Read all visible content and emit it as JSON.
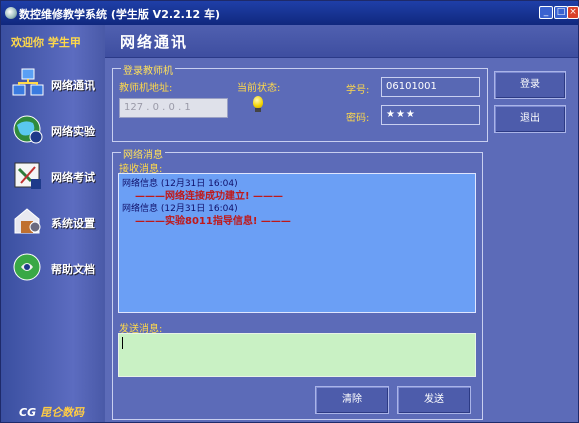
{
  "window": {
    "title": "数控维修教学系统 (学生版 V2.2.12 车)",
    "min_glyph": "_",
    "max_glyph": "□",
    "close_glyph": "×"
  },
  "sidebar": {
    "welcome": "欢迎你  学生甲",
    "items": [
      {
        "label": "网络通讯",
        "icon": "network-icon"
      },
      {
        "label": "网络实验",
        "icon": "globe-icon"
      },
      {
        "label": "网络考试",
        "icon": "exam-icon"
      },
      {
        "label": "系统设置",
        "icon": "settings-icon"
      },
      {
        "label": "帮助文档",
        "icon": "help-icon"
      }
    ],
    "brand_prefix": "CG",
    "brand_text": "昆仑数码"
  },
  "header": {
    "title": "网络通讯"
  },
  "login_group": {
    "legend": "登录教师机",
    "teacher_addr_label": "教师机地址:",
    "teacher_addr_value": "127 . 0 . 0 . 1",
    "status_label": "当前状态:",
    "student_id_label": "学号:",
    "student_id_value": "06101001",
    "password_label": "密码:",
    "password_value": "★★★",
    "login_button": "登录",
    "logout_button": "退出"
  },
  "message_group": {
    "legend": "网络消息",
    "receive_label": "接收消息:",
    "messages": [
      {
        "header": "网络信息 (12月31日 16:04)",
        "body": "———网络连接成功建立! ———"
      },
      {
        "header": "网络信息 (12月31日 16:04)",
        "body": "———实验8011指导信息! ———"
      }
    ],
    "send_label": "发送消息:",
    "send_value": "",
    "clear_button": "清除",
    "send_button": "发送"
  },
  "colors": {
    "sidebar": "#4a5aa8",
    "main_panel": "#5c6bb8",
    "receive_box": "#6b9ff5",
    "send_box": "#c9f1c4",
    "label_yellow": "#ffd94a",
    "message_red": "#c01818"
  }
}
